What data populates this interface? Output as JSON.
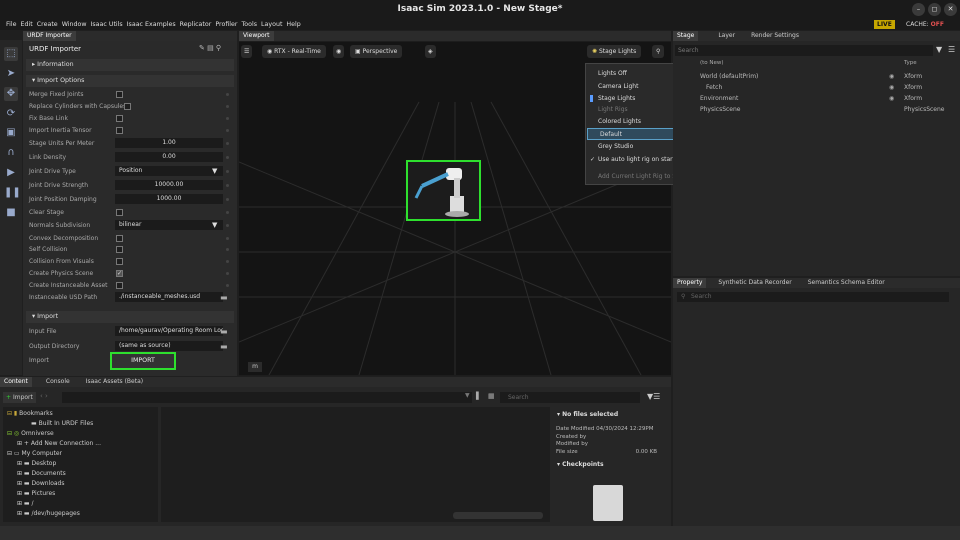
{
  "window": {
    "title": "Isaac Sim 2023.1.0 - New Stage*",
    "min": "–",
    "max": "◻",
    "close": "✕"
  },
  "menu": [
    "File",
    "Edit",
    "Create",
    "Window",
    "Isaac Utils",
    "Isaac Examples",
    "Replicator",
    "Profiler",
    "Tools",
    "Layout",
    "Help"
  ],
  "status": {
    "live": "LIVE",
    "cache": "CACHE:",
    "cache_state": "OFF"
  },
  "urdf": {
    "tab": "URDF Importer",
    "title": "URDF Importer",
    "info": "Information",
    "import_options": "Import Options",
    "labels": {
      "merge": "Merge Fixed Joints",
      "replace": "Replace Cylinders with Capsules",
      "fix": "Fix Base Link",
      "inertia": "Import Inertia Tensor",
      "units": "Stage Units Per Meter",
      "density": "Link Density",
      "jtype": "Joint Drive Type",
      "jstrength": "Joint Drive Strength",
      "jdamp": "Joint Position Damping",
      "clear": "Clear Stage",
      "normals": "Normals Subdivision",
      "convex": "Convex Decomposition",
      "selfcol": "Self Collision",
      "colvis": "Collision From Visuals",
      "physscene": "Create Physics Scene",
      "instanceable": "Create Instanceable Asset",
      "instpath": "Instanceable USD Path"
    },
    "values": {
      "units": "1.00",
      "density": "0.00",
      "jtype": "Position",
      "jstrength": "10000.00",
      "jdamp": "1000.00",
      "normals": "bilinear",
      "instpath": "./instanceable_meshes.usd"
    },
    "import_section": "Import",
    "input_label": "Input File",
    "input_value": "/home/gaurav/Operating Room Logs",
    "outdir_label": "Output Directory",
    "outdir_value": "(same as source)",
    "import_label": "Import",
    "import_button": "IMPORT"
  },
  "viewport": {
    "tab": "Viewport",
    "render": "RTX - Real-Time",
    "camera": "Perspective",
    "lights": "Stage Lights",
    "unit": "m"
  },
  "lights_menu": {
    "lights_off": "Lights Off",
    "camera_light": "Camera Light",
    "stage_lights": "Stage Lights",
    "rigs_header": "Light Rigs",
    "colored": "Colored Lights",
    "default": "Default",
    "grey": "Grey Studio",
    "auto": "Use auto light rig on startup",
    "add_current": "Add Current Light Rig to Stage"
  },
  "stage": {
    "tabs": [
      "Stage",
      "Layer",
      "Render Settings"
    ],
    "search_placeholder": "Search",
    "col_name": "(to New)",
    "col_type": "Type",
    "rows": [
      {
        "name": "World (defaultPrim)",
        "type": "Xform"
      },
      {
        "name": "Fetch",
        "type": "Xform"
      },
      {
        "name": "Environment",
        "type": "Xform"
      },
      {
        "name": "PhysicsScene",
        "type": "PhysicsScene"
      }
    ]
  },
  "property": {
    "tabs": [
      "Property",
      "Synthetic Data Recorder",
      "Semantics Schema Editor"
    ],
    "search_placeholder": "Search"
  },
  "content": {
    "tabs": [
      "Content",
      "Console",
      "Isaac Assets (Beta)"
    ],
    "import_btn": "Import",
    "search_placeholder": "Search",
    "tree": {
      "bookmarks": "Bookmarks",
      "built_in": "Built In URDF Files",
      "omniverse": "Omniverse",
      "add_conn": "Add New Connection ...",
      "mycomputer": "My Computer",
      "desktop": "Desktop",
      "documents": "Documents",
      "downloads": "Downloads",
      "pictures": "Pictures",
      "root": "/",
      "hugepages": "/dev/hugepages"
    },
    "details": {
      "no_files": "No files selected",
      "date_modified": "Date Modified 04/30/2024 12:29PM",
      "created_by": "Created by",
      "modified_by": "Modified by",
      "file_size_label": "File size",
      "file_size_value": "0.00 KB",
      "checkpoints": "Checkpoints"
    }
  }
}
